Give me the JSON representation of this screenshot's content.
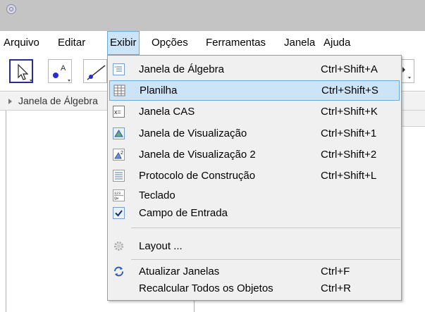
{
  "menubar": {
    "items": [
      "Arquivo",
      "Editar",
      "Exibir",
      "Opções",
      "Ferramentas",
      "Janela",
      "Ajuda"
    ],
    "active": "Exibir"
  },
  "panel": {
    "title": "Janela de Álgebra"
  },
  "exibir_menu": {
    "items": [
      {
        "label": "Janela de Álgebra",
        "shortcut": "Ctrl+Shift+A",
        "icon": "algebra-view-icon"
      },
      {
        "label": "Planilha",
        "shortcut": "Ctrl+Shift+S",
        "icon": "spreadsheet-icon",
        "highlighted": true
      },
      {
        "label": "Janela CAS",
        "shortcut": "Ctrl+Shift+K",
        "icon": "cas-icon"
      },
      {
        "label": "Janela de Visualização",
        "shortcut": "Ctrl+Shift+1",
        "icon": "graphics-view-icon",
        "checked": true
      },
      {
        "label": "Janela de Visualização 2",
        "shortcut": "Ctrl+Shift+2",
        "icon": "graphics-view-2-icon"
      },
      {
        "label": "Protocolo de Construção",
        "shortcut": "Ctrl+Shift+L",
        "icon": "construction-protocol-icon"
      },
      {
        "label": "Teclado",
        "shortcut": "",
        "icon": "keyboard-icon"
      },
      {
        "label": "Campo de Entrada",
        "shortcut": "",
        "icon": "checkmark-icon",
        "checked": true
      },
      {
        "label": "Layout ...",
        "shortcut": "",
        "icon": "gear-icon"
      },
      {
        "label": "Atualizar Janelas",
        "shortcut": "Ctrl+F",
        "icon": "refresh-icon"
      },
      {
        "label": "Recalcular Todos os Objetos",
        "shortcut": "Ctrl+R",
        "icon": ""
      }
    ]
  },
  "colors": {
    "highlight": "#cce4f7",
    "highlight_border": "#6aa9dd",
    "titlebar": "#c4c4c4"
  }
}
